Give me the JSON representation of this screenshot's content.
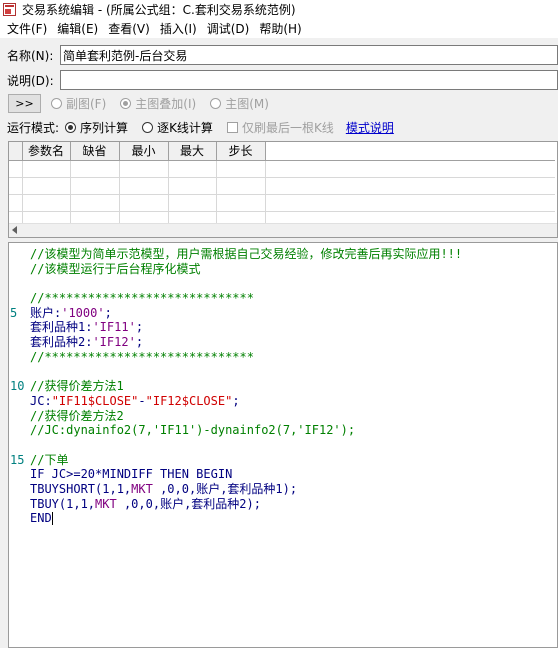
{
  "window": {
    "title": "交易系统编辑 - (所属公式组：C.套利交易系统范例)"
  },
  "menu": [
    {
      "label": "文件(F)"
    },
    {
      "label": "编辑(E)"
    },
    {
      "label": "查看(V)"
    },
    {
      "label": "插入(I)"
    },
    {
      "label": "调试(D)"
    },
    {
      "label": "帮助(H)"
    }
  ],
  "form": {
    "name_label": "名称(N):",
    "name_value": "简单套利范例-后台交易",
    "desc_label": "说明(D):",
    "desc_value": ""
  },
  "toolbar": {
    "more_button": ">>",
    "radios": [
      {
        "label": "副图(F)",
        "selected": false
      },
      {
        "label": "主图叠加(I)",
        "selected": true
      },
      {
        "label": "主图(M)",
        "selected": false
      }
    ]
  },
  "mode": {
    "label": "运行模式:",
    "options": [
      {
        "label": "序列计算",
        "selected": true
      },
      {
        "label": "逐K线计算",
        "selected": false
      }
    ],
    "checkbox_label": "仅刷最后一根K线",
    "help_link": "模式说明"
  },
  "param_table": {
    "columns": [
      "参数名",
      "缺省",
      "最小",
      "最大",
      "步长"
    ],
    "rows": 4
  },
  "code": {
    "lines": [
      {
        "num": "",
        "segs": [
          {
            "t": "//该模型为简单示范模型，用户需根据自己交易经验，修改完善后再实际应用!!!",
            "c": "c-cmt"
          }
        ]
      },
      {
        "num": "",
        "segs": [
          {
            "t": "//该模型运行于后台程序化模式",
            "c": "c-cmt"
          }
        ]
      },
      {
        "num": "",
        "segs": []
      },
      {
        "num": "",
        "segs": [
          {
            "t": "//*****************************",
            "c": "c-cmt"
          }
        ]
      },
      {
        "num": "5",
        "segs": [
          {
            "t": "账户:",
            "c": "c-def"
          },
          {
            "t": "'1000'",
            "c": "c-str"
          },
          {
            "t": ";",
            "c": "c-def"
          }
        ]
      },
      {
        "num": "",
        "segs": [
          {
            "t": "套利品种1:",
            "c": "c-def"
          },
          {
            "t": "'IF11'",
            "c": "c-str"
          },
          {
            "t": ";",
            "c": "c-def"
          }
        ]
      },
      {
        "num": "",
        "segs": [
          {
            "t": "套利品种2:",
            "c": "c-def"
          },
          {
            "t": "'IF12'",
            "c": "c-str"
          },
          {
            "t": ";",
            "c": "c-def"
          }
        ]
      },
      {
        "num": "",
        "segs": [
          {
            "t": "//*****************************",
            "c": "c-cmt"
          }
        ]
      },
      {
        "num": "",
        "segs": []
      },
      {
        "num": "10",
        "segs": [
          {
            "t": "//获得价差方法1",
            "c": "c-cmt"
          }
        ]
      },
      {
        "num": "",
        "segs": [
          {
            "t": "JC:",
            "c": "c-def"
          },
          {
            "t": "\"IF11$CLOSE\"",
            "c": "c-red"
          },
          {
            "t": "-",
            "c": "c-def"
          },
          {
            "t": "\"IF12$CLOSE\"",
            "c": "c-red"
          },
          {
            "t": ";",
            "c": "c-def"
          }
        ]
      },
      {
        "num": "",
        "segs": [
          {
            "t": "//获得价差方法2",
            "c": "c-cmt"
          }
        ]
      },
      {
        "num": "",
        "segs": [
          {
            "t": "//JC:dynainfo2(7,'IF11')-dynainfo2(7,'IF12');",
            "c": "c-cmt"
          }
        ]
      },
      {
        "num": "",
        "segs": []
      },
      {
        "num": "15",
        "segs": [
          {
            "t": "//下单",
            "c": "c-cmt"
          }
        ]
      },
      {
        "num": "",
        "segs": [
          {
            "t": "IF JC>=20*MINDIFF THEN BEGIN",
            "c": "c-def"
          }
        ]
      },
      {
        "num": "",
        "segs": [
          {
            "t": "TBUYSHORT(1,1,",
            "c": "c-def"
          },
          {
            "t": "MKT",
            "c": "c-str"
          },
          {
            "t": " ,0,0,账户,套利品种1);",
            "c": "c-def"
          }
        ]
      },
      {
        "num": "",
        "segs": [
          {
            "t": "TBUY(1,1,",
            "c": "c-def"
          },
          {
            "t": "MKT",
            "c": "c-str"
          },
          {
            "t": " ,0,0,账户,套利品种2);",
            "c": "c-def"
          }
        ]
      },
      {
        "num": "",
        "segs": [
          {
            "t": "END",
            "c": "c-def"
          }
        ],
        "caret": true
      }
    ]
  }
}
